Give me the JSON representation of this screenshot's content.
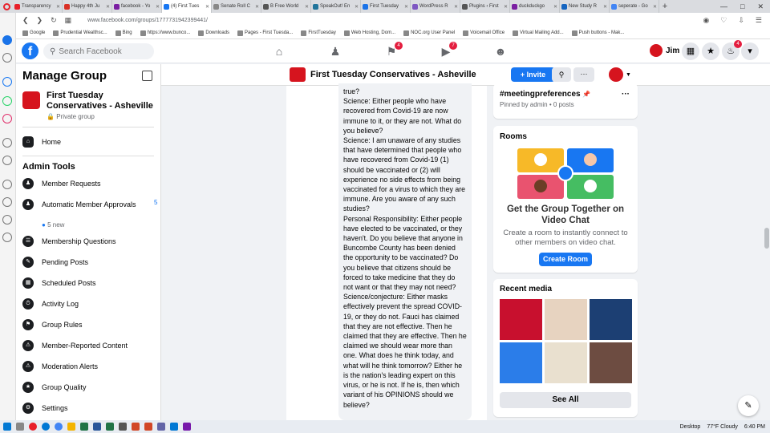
{
  "browser": {
    "tabs": [
      {
        "title": "Transparency",
        "color": "#e8202a"
      },
      {
        "title": "Happy 4th Ju",
        "color": "#d93025"
      },
      {
        "title": "facebook - Yo",
        "color": "#7b1fa2"
      },
      {
        "title": "(4) First Tues",
        "color": "#1877f2",
        "active": true
      },
      {
        "title": "Senate Roll C",
        "color": "#888888"
      },
      {
        "title": "B Free World",
        "color": "#555555"
      },
      {
        "title": "SpeakOut! En",
        "color": "#21759b"
      },
      {
        "title": "First Tuesday",
        "color": "#1a73e8"
      },
      {
        "title": "WordPress R",
        "color": "#7e57c2"
      },
      {
        "title": "Plugins ‹ First",
        "color": "#555555"
      },
      {
        "title": "duckduckgo",
        "color": "#7b1fa2"
      },
      {
        "title": "New Study R",
        "color": "#1565c0"
      },
      {
        "title": "seperate - Go",
        "color": "#4285f4"
      }
    ],
    "url": "www.facebook.com/groups/1777731942399441/",
    "bookmarks": [
      "Google",
      "Prudential Wealthsc...",
      "Bing",
      "https://www.bunco...",
      "Downloads",
      "Pages - First Tuesda...",
      "FirstTuesday",
      "Web Hosting, Dom...",
      "NOC.org User Panel",
      "Voicemail Office",
      "Virtual Mailing Add...",
      "Push buttons - Mak..."
    ]
  },
  "fb": {
    "search_placeholder": "Search Facebook",
    "user": "Jim",
    "groups_badge": "4",
    "watch_badge": "7",
    "notif_badge": "4"
  },
  "left": {
    "title": "Manage Group",
    "group_name": "First Tuesday Conservatives - Asheville",
    "privacy": "Private group",
    "home": "Home",
    "admin_tools": "Admin Tools",
    "items": [
      {
        "label": "Member Requests"
      },
      {
        "label": "Automatic Member Approvals",
        "count": "5",
        "sub": "5 new"
      },
      {
        "label": "Membership Questions"
      },
      {
        "label": "Pending Posts"
      },
      {
        "label": "Scheduled Posts"
      },
      {
        "label": "Activity Log"
      },
      {
        "label": "Group Rules"
      },
      {
        "label": "Member-Reported Content"
      },
      {
        "label": "Moderation Alerts"
      },
      {
        "label": "Group Quality"
      },
      {
        "label": "Settings"
      }
    ]
  },
  "groupbar": {
    "title": "First Tuesday Conservatives - Asheville",
    "invite": "+ Invite",
    "more": "···"
  },
  "post": {
    "paragraphs": [
      "true?",
      "Science: Either people who have recovered from Covid-19 are now immune to it, or they are not. What do you believe?",
      "Science: I am unaware of any studies that have determined that people who have recovered from Covid-19 (1) should be vaccinated or (2) will experience no side effects from being vaccinated for a virus to which they are immune. Are you aware of any such studies?",
      "Personal Responsibility: Either people have elected to be vaccinated, or they haven't. Do you believe that anyone in Buncombe County has been denied the opportunity to be vaccinated? Do you believe that citizens should be forced to take medicine that they do not want or that they may not need?",
      "Science/conjecture: Either masks effectively prevent the spread COVID-19, or they do not. Fauci has claimed that they are not effective. Then he claimed that they are effective. Then he claimed we should wear more than one. What does he think today, and what will he think tomorrow? Either he is the nation's leading expert on this virus, or he is not. If he is, then which variant of his OPINIONS should we believe?"
    ]
  },
  "right": {
    "hashtag": "#meetingpreferences",
    "pinned": "Pinned by admin • 0 posts",
    "rooms_title": "Rooms",
    "rooms_heading": "Get the Group Together on Video Chat",
    "rooms_desc": "Create a room to instantly connect to other members on video chat.",
    "create_room": "Create Room",
    "media_title": "Recent media",
    "see_all": "See All",
    "media_colors": [
      "#c8102e",
      "#e7d3c0",
      "#1c3f73",
      "#2b7de9",
      "#e9e0cf",
      "#6d4c41"
    ]
  },
  "taskbar": {
    "desktop": "Desktop",
    "weather": "77°F Cloudy",
    "time": "6:40 PM"
  }
}
